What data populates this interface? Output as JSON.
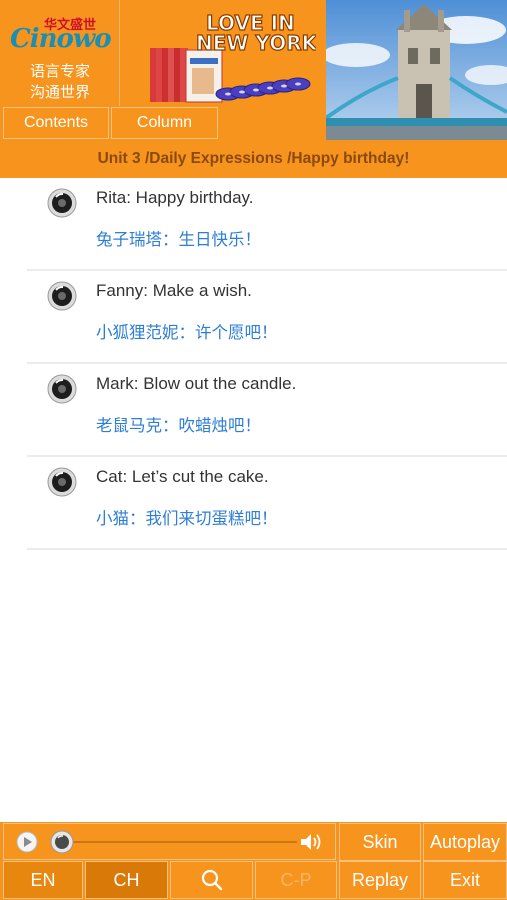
{
  "header": {
    "logo": {
      "brand_cn": "华文盛世",
      "brand_word": "Cinowo",
      "slogan_line1": "语言专家",
      "slogan_line2": "沟通世界"
    },
    "book_title_line1": "LOVE IN",
    "book_title_line2": "NEW YORK",
    "nav": {
      "contents_label": "Contents",
      "column_label": "Column"
    },
    "unit_title": "Unit 3 /Daily Expressions /Happy birthday!"
  },
  "dialogue": [
    {
      "en": "Rita: Happy birthday.",
      "cn": "兔子瑞塔：生日快乐！"
    },
    {
      "en": "Fanny: Make a wish.",
      "cn": "小狐狸范妮：许个愿吧！"
    },
    {
      "en": "Mark: Blow out the candle.",
      "cn": "老鼠马克：吹蜡烛吧！"
    },
    {
      "en": "Cat: Let’s cut the cake.",
      "cn": "小猫：我们来切蛋糕吧！"
    }
  ],
  "controls": {
    "skin_label": "Skin",
    "autoplay_label": "Autoplay",
    "en_label": "EN",
    "ch_label": "CH",
    "cp_label": "C-P",
    "replay_label": "Replay",
    "exit_label": "Exit",
    "playback_progress": 0.0
  },
  "icons": {
    "speaker": "speaker-icon",
    "play": "play-icon",
    "volume": "volume-icon",
    "search": "search-icon"
  },
  "colors": {
    "accent": "#F7941D",
    "unit_title": "#8a4a0f",
    "chinese_text": "#2e7ed6",
    "english_text": "#333333"
  }
}
